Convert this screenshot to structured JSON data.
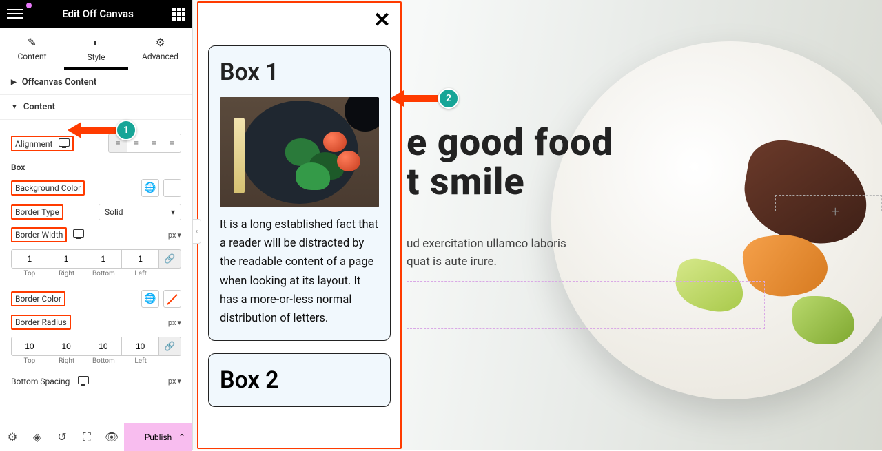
{
  "panel": {
    "title": "Edit Off Canvas",
    "tabs": {
      "content": "Content",
      "style": "Style",
      "advanced": "Advanced"
    },
    "section_offcanvas": "Offcanvas Content",
    "section_content": "Content",
    "labels": {
      "alignment": "Alignment",
      "box": "Box",
      "bgcolor": "Background Color",
      "border_type": "Border Type",
      "border_width": "Border Width",
      "border_color": "Border Color",
      "border_radius": "Border Radius",
      "bottom_spacing": "Bottom Spacing"
    },
    "border_type_value": "Solid",
    "units": {
      "px": "px"
    },
    "sides": {
      "top": "Top",
      "right": "Right",
      "bottom": "Bottom",
      "left": "Left"
    },
    "border_width_values": {
      "top": "1",
      "right": "1",
      "bottom": "1",
      "left": "1"
    },
    "border_radius_values": {
      "top": "10",
      "right": "10",
      "bottom": "10",
      "left": "10"
    }
  },
  "footer": {
    "publish": "Publish"
  },
  "offcanvas": {
    "box1": {
      "title": "Box 1",
      "text": "It is a long established fact that a reader will be distracted by the readable content of a page when looking at its layout.  It has a more-or-less normal distribution of letters."
    },
    "box2": {
      "title": "Box 2"
    }
  },
  "hero": {
    "line1_partial": "e good food",
    "line2_partial": "t smile",
    "sub_part1": "ud exercitation ullamco laboris",
    "sub_part2": "quat is aute irure."
  },
  "annotations": {
    "badge1": "1",
    "badge2": "2"
  }
}
